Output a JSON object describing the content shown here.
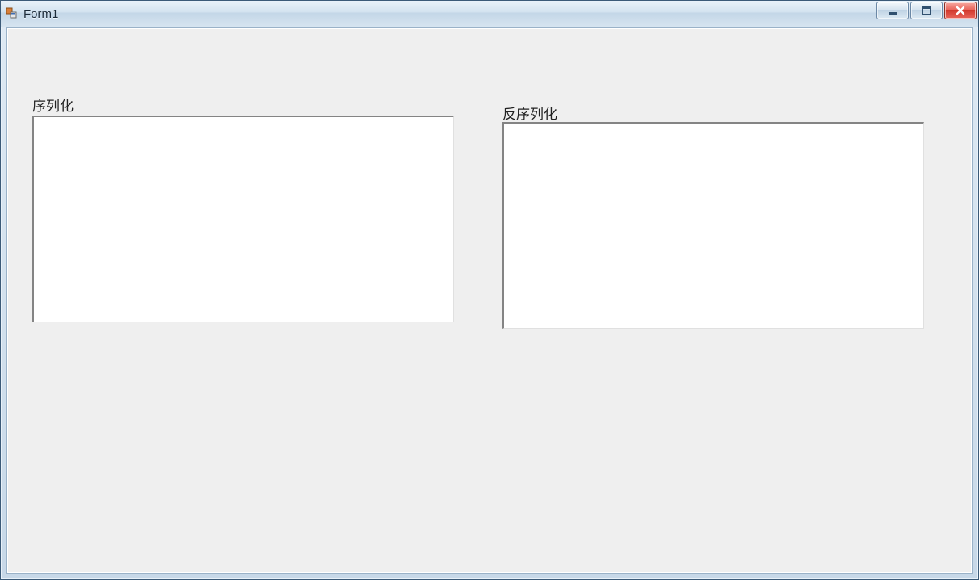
{
  "window": {
    "title": "Form1"
  },
  "panels": {
    "left": {
      "label": "序列化",
      "value": ""
    },
    "right": {
      "label": "反序列化",
      "value": ""
    }
  }
}
